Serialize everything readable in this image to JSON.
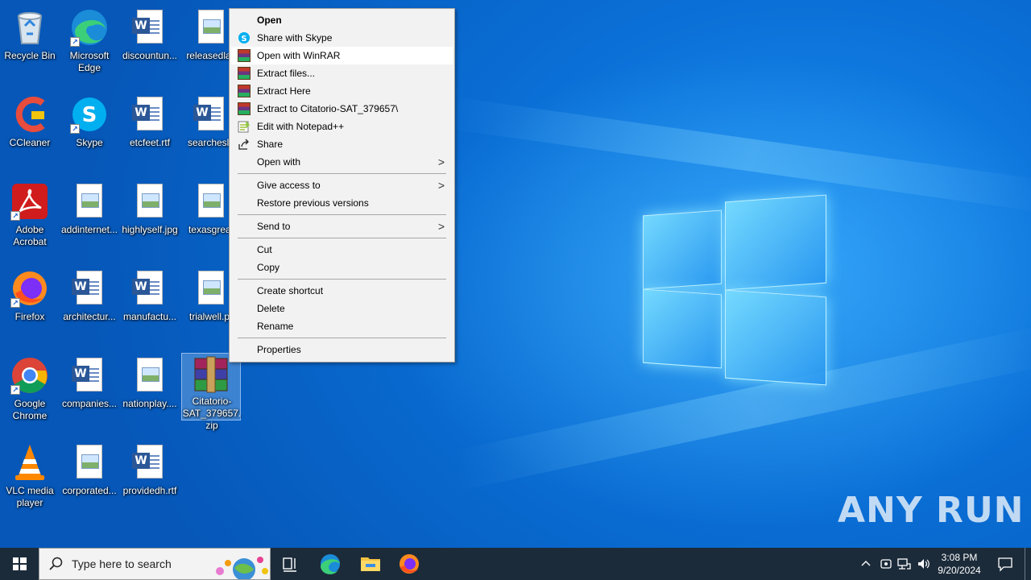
{
  "desktop": {
    "icons": [
      {
        "label": "Recycle Bin"
      },
      {
        "label": "Microsoft Edge"
      },
      {
        "label": "discountun..."
      },
      {
        "label": "releasedlas"
      },
      {
        "label": "CCleaner"
      },
      {
        "label": "Skype"
      },
      {
        "label": "etcfeet.rtf"
      },
      {
        "label": "searchesla"
      },
      {
        "label": "Adobe Acrobat"
      },
      {
        "label": "addinternet..."
      },
      {
        "label": "highlyself.jpg"
      },
      {
        "label": "texasgreat"
      },
      {
        "label": "Firefox"
      },
      {
        "label": "architectur..."
      },
      {
        "label": "manufactu..."
      },
      {
        "label": "trialwell.pr"
      },
      {
        "label": "Google Chrome"
      },
      {
        "label": "companies..."
      },
      {
        "label": "nationplay...."
      },
      {
        "label": "Citatorio-SAT_379657.zip"
      },
      {
        "label": "VLC media player"
      },
      {
        "label": "corporated..."
      },
      {
        "label": "providedh.rtf"
      }
    ]
  },
  "context_menu": {
    "items": [
      {
        "label": "Open"
      },
      {
        "label": "Share with Skype"
      },
      {
        "label": "Open with WinRAR"
      },
      {
        "label": "Extract files..."
      },
      {
        "label": "Extract Here"
      },
      {
        "label": "Extract to Citatorio-SAT_379657\\"
      },
      {
        "label": "Edit with Notepad++"
      },
      {
        "label": "Share"
      },
      {
        "label": "Open with"
      },
      {
        "label": "Give access to"
      },
      {
        "label": "Restore previous versions"
      },
      {
        "label": "Send to"
      },
      {
        "label": "Cut"
      },
      {
        "label": "Copy"
      },
      {
        "label": "Create shortcut"
      },
      {
        "label": "Delete"
      },
      {
        "label": "Rename"
      },
      {
        "label": "Properties"
      }
    ],
    "submenu_arrow": ">"
  },
  "taskbar": {
    "search_placeholder": "Type here to search",
    "clock_time": "3:08 PM",
    "clock_date": "9/20/2024"
  },
  "watermark": "ANY RUN",
  "colors": {
    "desktop_blue": "#0a6ed8",
    "taskbar": "#1c2b3a",
    "menu_bg": "#f2f2f2"
  }
}
